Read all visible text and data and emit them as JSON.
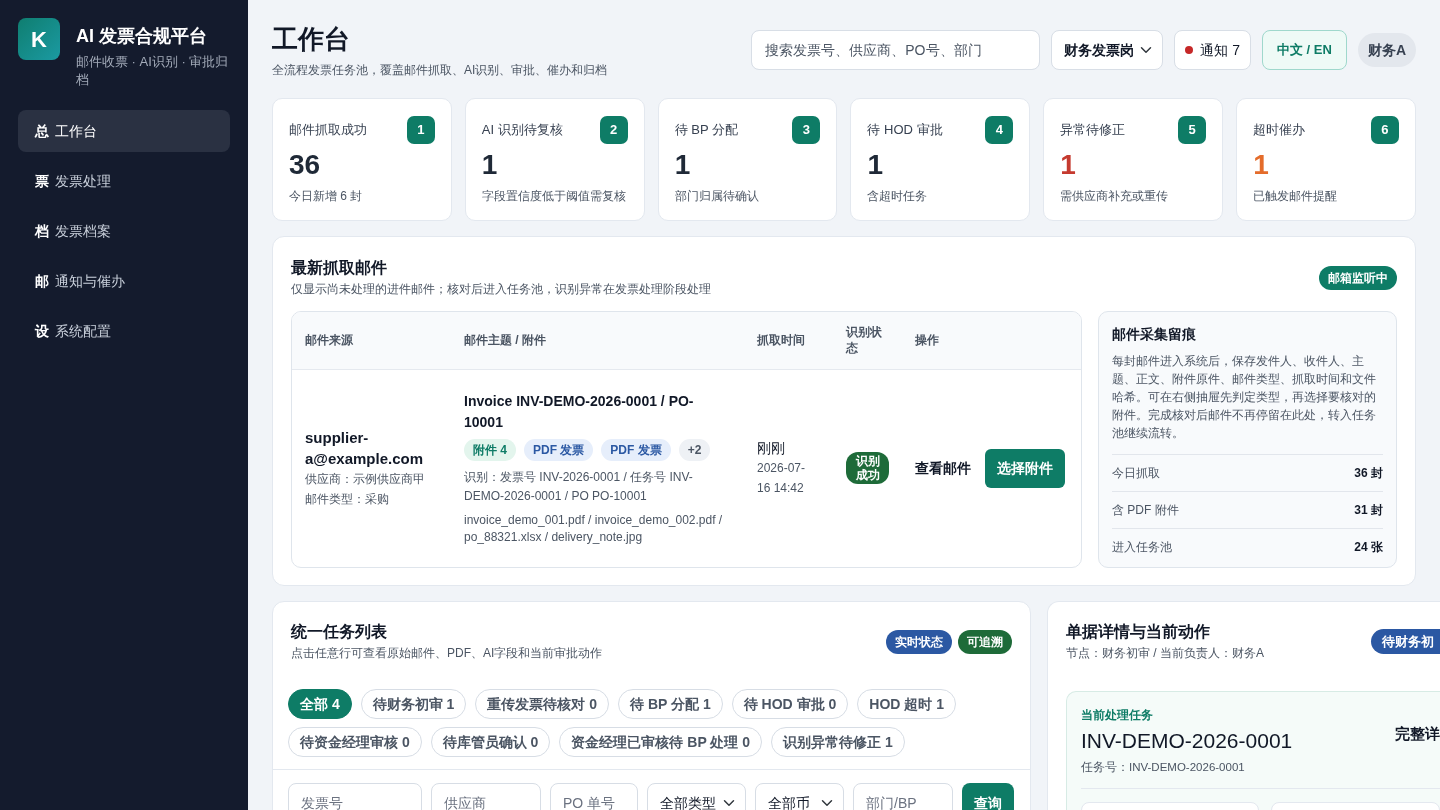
{
  "sidebar": {
    "logo_letter": "K",
    "title": "AI 发票合规平台",
    "subtitle": "邮件收票 · AI识别 · 审批归档",
    "items": [
      {
        "icon": "总",
        "label": "工作台",
        "selected": true
      },
      {
        "icon": "票",
        "label": "发票处理",
        "selected": false
      },
      {
        "icon": "档",
        "label": "发票档案",
        "selected": false
      },
      {
        "icon": "邮",
        "label": "通知与催办",
        "selected": false
      },
      {
        "icon": "设",
        "label": "系统配置",
        "selected": false
      }
    ]
  },
  "header": {
    "title": "工作台",
    "subtitle": "全流程发票任务池，覆盖邮件抓取、AI识别、审批、催办和归档",
    "search": {
      "placeholder": "搜索发票号、供应商、PO号、部门"
    },
    "role_select": {
      "value": "财务发票岗"
    },
    "notifications": "通知 7",
    "language_button": "中文 / EN",
    "user": "财务A"
  },
  "stats": [
    {
      "label": "邮件抓取成功",
      "index": "1",
      "value": "36",
      "caption": "今日新增 6 封",
      "color": "#1f2937"
    },
    {
      "label": "AI 识别待复核",
      "index": "2",
      "value": "1",
      "caption": "字段置信度低于阈值需复核",
      "color": "#1f2937"
    },
    {
      "label": "待 BP 分配",
      "index": "3",
      "value": "1",
      "caption": "部门归属待确认",
      "color": "#1f2937"
    },
    {
      "label": "待 HOD 审批",
      "index": "4",
      "value": "1",
      "caption": "含超时任务",
      "color": "#1f2937"
    },
    {
      "label": "异常待修正",
      "index": "5",
      "value": "1",
      "caption": "需供应商补充或重传",
      "color": "#c53a2f"
    },
    {
      "label": "超时催办",
      "index": "6",
      "value": "1",
      "caption": "已触发邮件提醒",
      "color": "#e46c2b"
    }
  ],
  "mail_panel": {
    "title": "最新抓取邮件",
    "subtitle": "仅显示尚未处理的进件邮件；核对后进入任务池，识别异常在发票处理阶段处理",
    "status_badge": "邮箱监听中",
    "table": {
      "columns": [
        "邮件来源",
        "邮件主题 / 附件",
        "抓取时间",
        "识别状态",
        "操作"
      ],
      "rows": [
        {
          "sender": "supplier-a@example.com",
          "supplier": "供应商：示例供应商甲",
          "mail_type": "邮件类型：采购",
          "subject": "Invoice INV-DEMO-2026-0001 / PO-10001",
          "tags": [
            {
              "label": "附件 4",
              "kind": "count"
            },
            {
              "label": "PDF 发票",
              "kind": "type"
            },
            {
              "label": "PDF 发票",
              "kind": "type"
            },
            {
              "label": "+2",
              "kind": "more"
            }
          ],
          "recognition": "识别：发票号 INV-2026-0001 / 任务号 INV-DEMO-2026-0001 / PO PO-10001",
          "files": "invoice_demo_001.pdf / invoice_demo_002.pdf / po_88321.xlsx / delivery_note.jpg",
          "time": "刚刚",
          "timestamp": "2026-07-16 14:42",
          "status": "识别成功",
          "view_link": "查看邮件",
          "select_button": "选择附件"
        }
      ]
    },
    "trace": {
      "title": "邮件采集留痕",
      "text": "每封邮件进入系统后，保存发件人、收件人、主题、正文、附件原件、邮件类型、抓取时间和文件哈希。可在右侧抽屉先判定类型，再选择要核对的附件。完成核对后邮件不再停留在此处，转入任务池继续流转。",
      "stats": [
        {
          "label": "今日抓取",
          "value": "36 封"
        },
        {
          "label": "含 PDF 附件",
          "value": "31 封"
        },
        {
          "label": "进入任务池",
          "value": "24 张"
        }
      ]
    }
  },
  "task_list": {
    "title": "统一任务列表",
    "subtitle": "点击任意行可查看原始邮件、PDF、AI字段和当前审批动作",
    "badges": [
      {
        "label": "实时状态",
        "color": "#2b58a3"
      },
      {
        "label": "可追溯",
        "color": "#1e6b39"
      }
    ],
    "filters": [
      {
        "label": "全部 4",
        "selected": true
      },
      {
        "label": "待财务初审 1",
        "selected": false
      },
      {
        "label": "重传发票待核对 0",
        "selected": false
      },
      {
        "label": "待 BP 分配 1",
        "selected": false
      },
      {
        "label": "待 HOD 审批 0",
        "selected": false
      },
      {
        "label": "HOD 超时 1",
        "selected": false
      },
      {
        "label": "待资金经理审核 0",
        "selected": false
      },
      {
        "label": "待库管员确认 0",
        "selected": false
      },
      {
        "label": "资金经理已审核待 BP 处理 0",
        "selected": false
      },
      {
        "label": "识别异常待修正 1",
        "selected": false
      }
    ],
    "search_fields": [
      {
        "kind": "input",
        "placeholder": "发票号"
      },
      {
        "kind": "input",
        "placeholder": "供应商"
      },
      {
        "kind": "input",
        "placeholder": "PO 单号"
      },
      {
        "kind": "select",
        "value": "全部类型"
      },
      {
        "kind": "select",
        "value": "全部币"
      },
      {
        "kind": "input",
        "placeholder": "部门/BP"
      }
    ],
    "query_button": "查询"
  },
  "detail": {
    "title": "单据详情与当前动作",
    "subtitle": "节点：财务初审 / 当前负责人：财务A",
    "status_badge": "待财务初",
    "current": {
      "label": "当前处理任务",
      "invoice": "INV-DEMO-2026-0001",
      "task_no": "任务号：INV-DEMO-2026-0001",
      "link": "完整详"
    }
  }
}
